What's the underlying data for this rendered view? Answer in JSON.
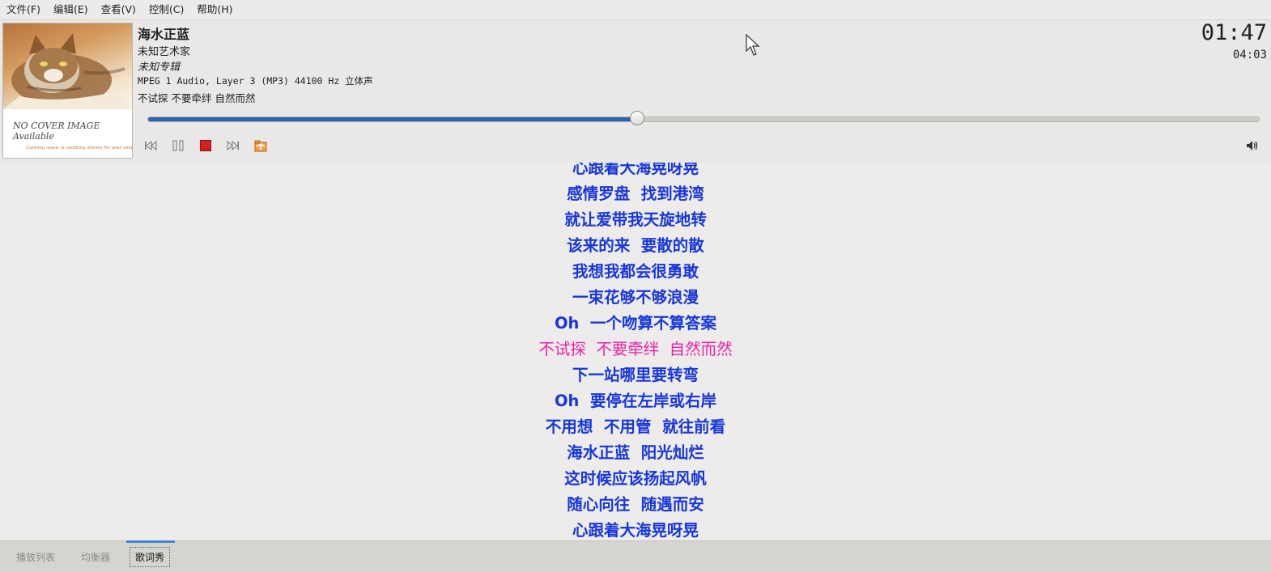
{
  "menu": [
    "文件(F)",
    "编辑(E)",
    "查看(V)",
    "控制(C)",
    "帮助(H)"
  ],
  "cover": {
    "line1": "NO COVER IMAGE",
    "line2": "Available",
    "tagline": "Calming music & soothing stories for your soul"
  },
  "track": {
    "title": "海水正蓝",
    "artist": "未知艺术家",
    "album": "未知专辑",
    "format": "MPEG 1 Audio, Layer 3 (MP3) 44100 Hz 立体声",
    "current_lyric": "不试探  不要牵绊  自然而然",
    "elapsed": "01:47",
    "total": "04:03",
    "progress_fraction": 0.44
  },
  "controls": {
    "previous": "previous-icon",
    "pause": "pause-icon",
    "stop": "stop-icon",
    "next": "next-icon",
    "open": "open-folder-icon",
    "volume": "volume-icon"
  },
  "lyrics": {
    "active_index": 7,
    "lines": [
      "心跟着大海晃呀晃",
      "感情罗盘  找到港湾",
      "就让爱带我天旋地转",
      "该来的来  要散的散",
      "我想我都会很勇敢",
      "一束花够不够浪漫",
      "Oh  一个吻算不算答案",
      "不试探  不要牵绊  自然而然",
      "下一站哪里要转弯",
      "Oh  要停在左岸或右岸",
      "不用想  不用管  就往前看",
      "海水正蓝  阳光灿烂",
      "这时候应该扬起风帆",
      "随心向往  随遇而安",
      "心跟着大海晃呀晃"
    ]
  },
  "tabs": [
    "播放列表",
    "均衡器",
    "歌词秀"
  ],
  "selected_tab": 2,
  "colors": {
    "lyric": "#1736dc",
    "lyric_active": "#f01fa8",
    "progress_fill": "#2e62ae",
    "stop_button": "#d42020",
    "tab_indicator": "#3e85d7"
  }
}
